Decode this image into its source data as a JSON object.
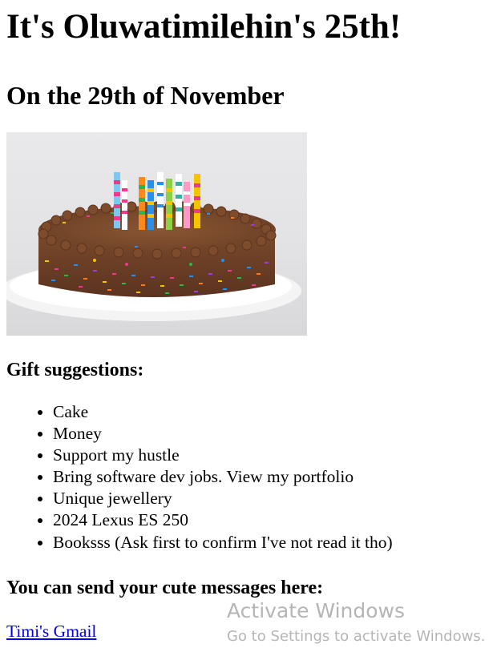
{
  "page": {
    "title": "It's Oluwatimilehin's 25th!",
    "subtitle": "On the 29th of November",
    "gift_heading": "Gift suggestions:",
    "gifts": [
      "Cake",
      "Money",
      "Support my hustle",
      "Bring software dev jobs. View my portfolio",
      "Unique jewellery",
      "2024 Lexus ES 250",
      "Booksss (Ask first to confirm I've not read it tho)"
    ],
    "messages_heading": "You can send your cute messages here:",
    "gmail_link": "Timi's Gmail"
  },
  "image": {
    "icon": "birthday-cake-photo"
  },
  "watermark": {
    "title": "Activate Windows",
    "subtitle": "Go to Settings to activate Windows."
  },
  "colors": {
    "link": "#0000ee",
    "text": "#000000"
  }
}
